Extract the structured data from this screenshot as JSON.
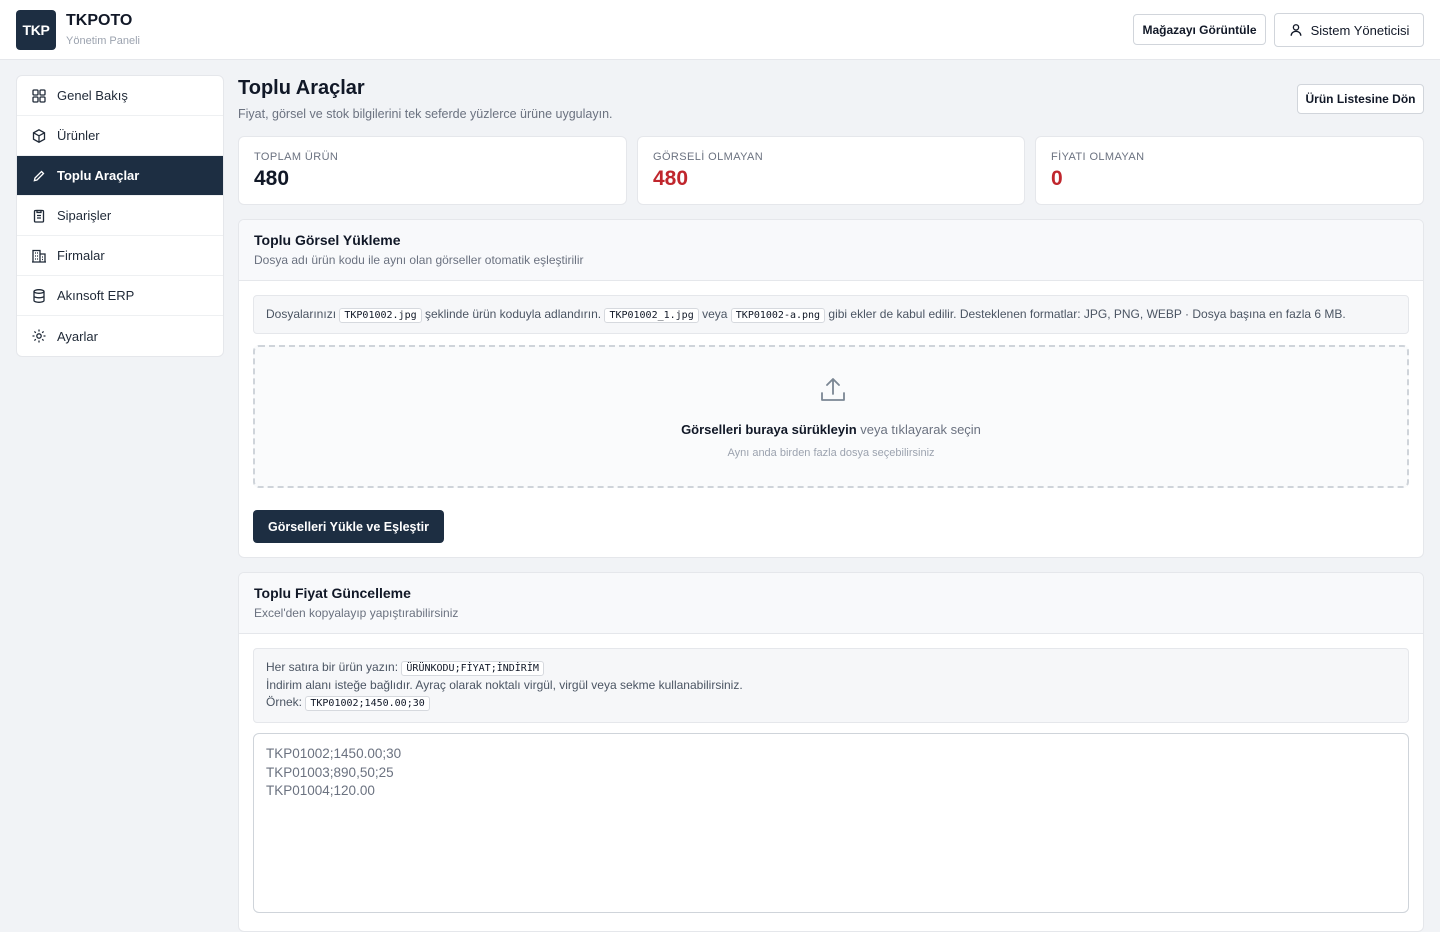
{
  "header": {
    "logo_text": "TKP",
    "title": "TKPOTO",
    "subtitle": "Yönetim Paneli",
    "store_button": "Mağazayı Görüntüle",
    "user_button": "Sistem Yöneticisi"
  },
  "sidebar": {
    "items": [
      {
        "label": "Genel Bakış",
        "icon": "grid-icon",
        "active": false
      },
      {
        "label": "Ürünler",
        "icon": "box-icon",
        "active": false
      },
      {
        "label": "Toplu Araçlar",
        "icon": "pen-icon",
        "active": true
      },
      {
        "label": "Siparişler",
        "icon": "clipboard-icon",
        "active": false
      },
      {
        "label": "Firmalar",
        "icon": "building-icon",
        "active": false
      },
      {
        "label": "Akınsoft ERP",
        "icon": "database-icon",
        "active": false
      },
      {
        "label": "Ayarlar",
        "icon": "gear-icon",
        "active": false
      }
    ]
  },
  "page": {
    "title": "Toplu Araçlar",
    "subtitle": "Fiyat, görsel ve stok bilgilerini tek seferde yüzlerce ürüne uygulayın.",
    "back_button": "Ürün Listesine Dön"
  },
  "stats": [
    {
      "label": "TOPLAM ÜRÜN",
      "value": "480"
    },
    {
      "label": "GÖRSELİ OLMAYAN",
      "value": "480"
    },
    {
      "label": "FİYATI OLMAYAN",
      "value": "0"
    }
  ],
  "image_upload": {
    "title": "Toplu Görsel Yükleme",
    "subtitle": "Dosya adı ürün kodu ile aynı olan görseller otomatik eşleştirilir",
    "info_prefix": "Dosyalarınızı",
    "code_1": "TKP01002.jpg",
    "info_mid_1": "şeklinde ürün koduyla adlandırın.",
    "code_2": "TKP01002_1.jpg",
    "info_mid_2": "veya",
    "code_3": "TKP01002-a.png",
    "info_suffix": "gibi ekler de kabul edilir. Desteklenen formatlar: JPG, PNG, WEBP · Dosya başına en fazla 6 MB.",
    "drop_bold": "Görselleri buraya sürükleyin",
    "drop_rest": " veya tıklayarak seçin",
    "drop_hint": "Aynı anda birden fazla dosya seçebilirsiniz",
    "button": "Görselleri Yükle ve Eşleştir"
  },
  "price_update": {
    "title": "Toplu Fiyat Güncelleme",
    "subtitle": "Excel'den kopyalayıp yapıştırabilirsiniz",
    "line1_prefix": "Her satıra bir ürün yazın:",
    "line1_code": "ÜRÜNKODU;FİYAT;İNDİRİM",
    "line2": "İndirim alanı isteğe bağlıdır. Ayraç olarak noktalı virgül, virgül veya sekme kullanabilirsiniz.",
    "line3_prefix": "Örnek:",
    "line3_code": "TKP01002;1450.00;30",
    "placeholder_lines": [
      "TKP01002;1450.00;30",
      "TKP01003;890,50;25",
      "TKP01004;120.00"
    ]
  },
  "colors": {
    "navy": "#1d2e42",
    "danger": "#c0262d"
  }
}
